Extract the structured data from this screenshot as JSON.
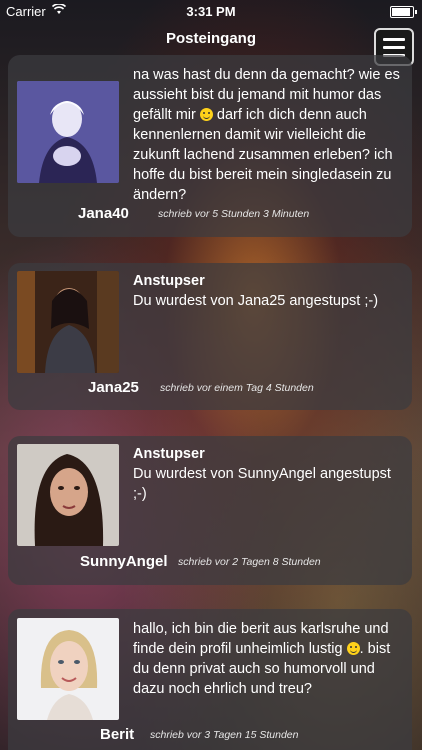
{
  "status_bar": {
    "carrier": "Carrier",
    "time": "3:31 PM"
  },
  "header": {
    "title": "Posteingang"
  },
  "messages": [
    {
      "text_a": "na was hast du denn da gemacht? wie es aussieht bist du jemand mit humor das gefällt mir",
      "text_b": "darf ich dich denn auch kennenlernen damit wir vielleicht die zukunft lachend zusammen erleben? ich hoffe du bist bereit mein singledasein zu ändern?",
      "name": "Jana40",
      "meta": "schrieb vor 5 Stunden 3 Minuten"
    },
    {
      "subject": "Anstupser",
      "text": "Du wurdest von Jana25 angestupst ;-)",
      "name": "Jana25",
      "meta": "schrieb vor einem Tag 4 Stunden"
    },
    {
      "subject": "Anstupser",
      "text": "Du wurdest von SunnyAngel angestupst ;-)",
      "name": "SunnyAngel",
      "meta": "schrieb vor 2 Tagen 8 Stunden"
    },
    {
      "text_a": "hallo, ich bin die berit aus karlsruhe und finde dein profil unheimlich lustig",
      "text_b": ". bist du denn privat auch so humorvoll und dazu noch ehrlich und treu?",
      "name": "Berit",
      "meta": "schrieb vor 3 Tagen 15 Stunden"
    }
  ]
}
